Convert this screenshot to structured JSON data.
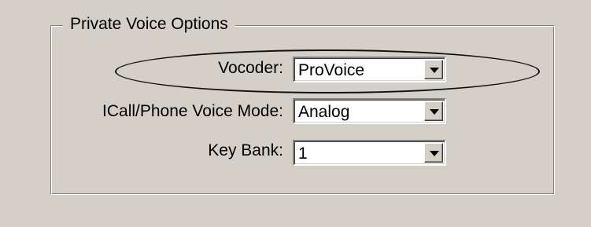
{
  "group": {
    "title": "Private Voice Options"
  },
  "fields": [
    {
      "label": "Vocoder:",
      "value": "ProVoice",
      "icon": "chevron-down-icon"
    },
    {
      "label": "ICall/Phone Voice Mode:",
      "value": "Analog",
      "icon": "chevron-down-icon"
    },
    {
      "label": "Key Bank:",
      "value": "1",
      "icon": "chevron-down-icon"
    }
  ],
  "colors": {
    "window_background": "#d4d0c8",
    "combo_background": "#ffffff",
    "annotation_outline": "#111111"
  }
}
